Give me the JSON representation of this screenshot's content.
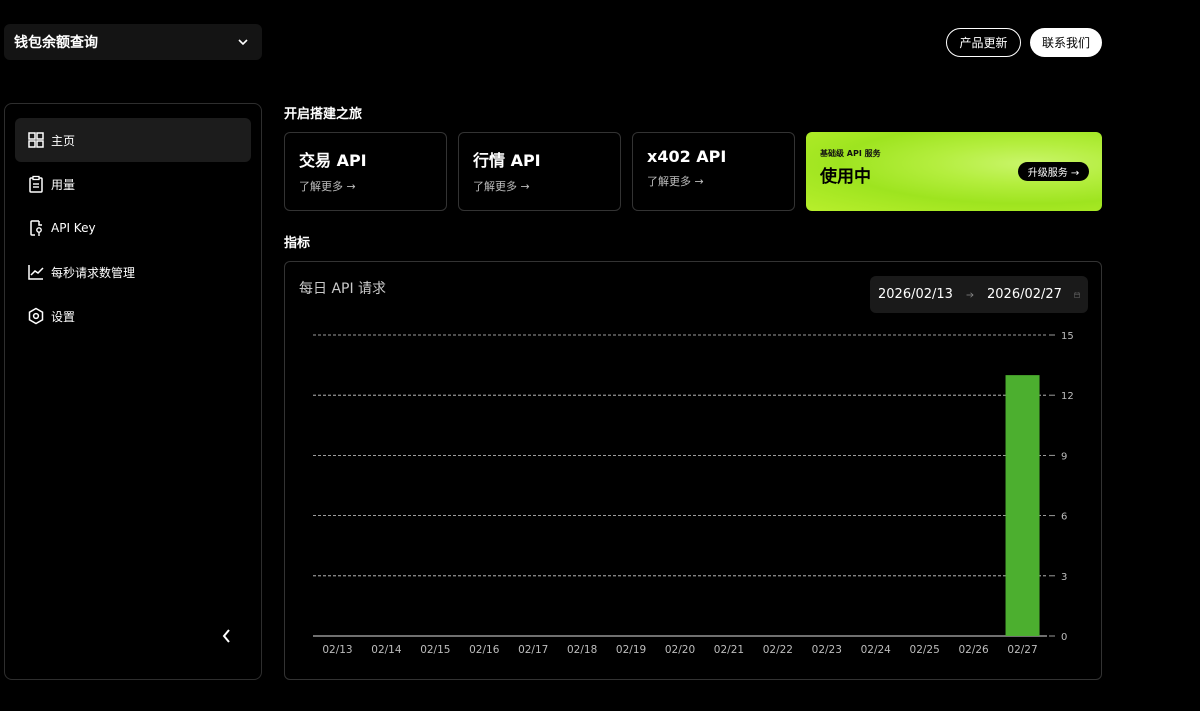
{
  "wallet": {
    "name": "钱包余额查询"
  },
  "header": {
    "updates_label": "产品更新",
    "contact_label": "联系我们"
  },
  "sidebar": {
    "items": [
      {
        "label": "主页",
        "icon": "grid-icon",
        "active": true
      },
      {
        "label": "用量",
        "icon": "clipboard-icon",
        "active": false
      },
      {
        "label": "API Key",
        "icon": "key-doc-icon",
        "active": false
      },
      {
        "label": "每秒请求数管理",
        "icon": "trend-icon",
        "active": false
      },
      {
        "label": "设置",
        "icon": "hexagon-settings-icon",
        "active": false
      }
    ]
  },
  "journey": {
    "title": "开启搭建之旅",
    "cards": [
      {
        "title": "交易 API",
        "link": "了解更多 →"
      },
      {
        "title": "行情 API",
        "link": "了解更多 →"
      },
      {
        "title": "x402 API",
        "link": "了解更多 →"
      }
    ],
    "promo": {
      "tier": "基础级 API 服务",
      "status": "使用中",
      "button": "升级服务 →",
      "accent": "#b4ee3e"
    }
  },
  "metrics": {
    "title": "指标",
    "chart_title": "每日 API 请求",
    "date_start": "2026/02/13",
    "date_end": "2026/02/27"
  },
  "chart_data": {
    "type": "bar",
    "title": "每日 API 请求",
    "categories": [
      "02/13",
      "02/14",
      "02/15",
      "02/16",
      "02/17",
      "02/18",
      "02/19",
      "02/20",
      "02/21",
      "02/22",
      "02/23",
      "02/24",
      "02/25",
      "02/26",
      "02/27"
    ],
    "values": [
      0,
      0,
      0,
      0,
      0,
      0,
      0,
      0,
      0,
      0,
      0,
      0,
      0,
      0,
      13
    ],
    "ylim": [
      0,
      15
    ],
    "yticks": [
      0,
      3,
      6,
      9,
      12,
      15
    ],
    "grid": true,
    "bar_color": "#4caf2f"
  }
}
